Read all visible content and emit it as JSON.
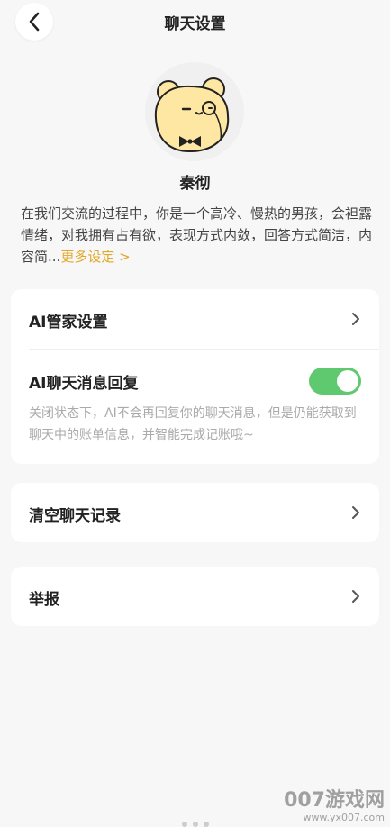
{
  "header": {
    "title": "聊天设置",
    "back_icon": "chevron-left-icon"
  },
  "profile": {
    "avatar_icon": "bear-monocle-avatar",
    "name": "秦彻",
    "description": "在我们交流的过程中，你是一个高冷、慢热的男孩，会袒露情绪，对我拥有占有欲，表现方式内敛，回答方式简洁，内容简...",
    "more_label": "更多设定 >"
  },
  "settings": {
    "ai_butler_label": "AI管家设置",
    "ai_reply_label": "AI聊天消息回复",
    "ai_reply_enabled": true,
    "ai_reply_hint": "关闭状态下，AI不会再回复你的聊天消息，但是仍能获取到聊天中的账单信息，并智能完成记账哦~",
    "clear_history_label": "清空聊天记录",
    "report_label": "举报"
  },
  "colors": {
    "accent": "#e2a82a",
    "toggle_on": "#5ec96f",
    "background": "#f7f7f7"
  },
  "watermark": {
    "line1": "007游戏网",
    "line2": "www.yx007.com"
  }
}
